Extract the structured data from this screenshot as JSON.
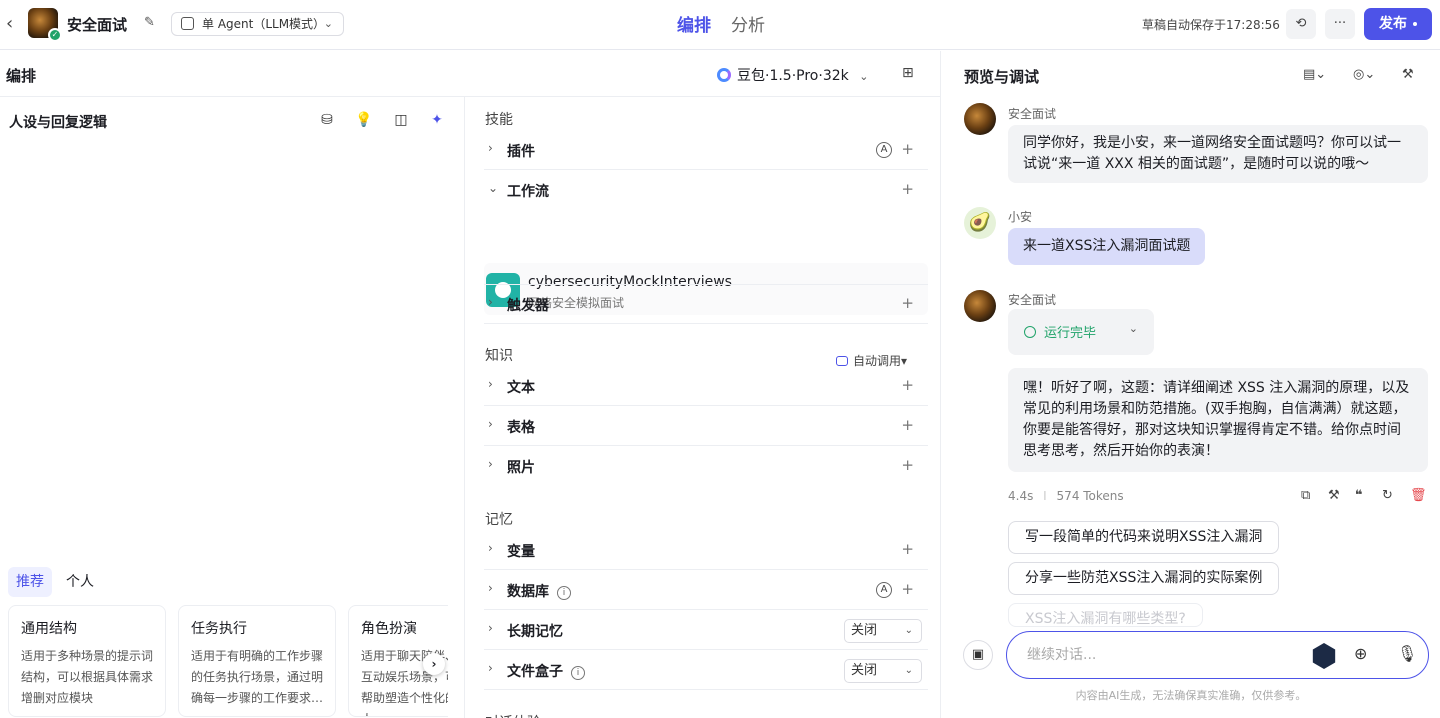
{
  "topbar": {
    "app_title": "安全面试",
    "mode_label": "单 Agent（LLM模式）",
    "tab_edit": "编排",
    "tab_analysis": "分析",
    "autosave": "草稿自动保存于17:28:56",
    "publish_label": "发布",
    "more_label": "···"
  },
  "edit": {
    "title": "编排",
    "model_label": "豆包·1.5·Pro·32k",
    "persona_title": "人设与回复逻辑",
    "template_tabs": [
      "推荐",
      "个人"
    ],
    "templates": [
      {
        "title": "通用结构",
        "desc": "适用于多种场景的提示词结构，可以根据具体需求增删对应模块"
      },
      {
        "title": "任务执行",
        "desc": "适用于有明确的工作步骤的任务执行场景，通过明确每一步骤的工作要求…"
      },
      {
        "title": "角色扮演",
        "desc": "适用于聊天陪伴、互动娱乐场景，可帮助塑造个性化的人…"
      }
    ]
  },
  "skills": {
    "section_skill": "技能",
    "plugins": "插件",
    "workflow": "工作流",
    "workflow_item": {
      "name": "cybersecurityMockInterviews",
      "desc": "网络安全模拟面试"
    },
    "trigger": "触发器",
    "section_knowledge": "知识",
    "auto_call": "自动调用",
    "text": "文本",
    "table": "表格",
    "photo": "照片",
    "section_memory": "记忆",
    "variable": "变量",
    "database": "数据库",
    "long_memory": "长期记忆",
    "long_memory_value": "关闭",
    "filebox": "文件盒子",
    "filebox_value": "关闭",
    "section_dialog": "对话体验"
  },
  "preview": {
    "title": "预览与调试",
    "bot_name": "安全面试",
    "user_name": "小安",
    "greeting": "同学你好，我是小安，来一道网络安全面试题吗？你可以试一试说“来一道 XXX 相关的面试题”，是随时可以说的哦～",
    "user_msg": "来一道XSS注入漏洞面试题",
    "run_status": "运行完毕",
    "answer": "嘿！听好了啊，这题：请详细阐述 XSS 注入漏洞的原理，以及常见的利用场景和防范措施。(双手抱胸，自信满满）就这题，你要是能答得好，那对这块知识掌握得肯定不错。给你点时间思考思考，然后开始你的表演！",
    "latency": "4.4s",
    "tokens": "574 Tokens",
    "suggestions": [
      "写一段简单的代码来说明XSS注入漏洞",
      "分享一些防范XSS注入漏洞的实际案例",
      "XSS注入漏洞有哪些类型?"
    ],
    "input_placeholder": "继续对话...",
    "disclaimer": "内容由AI生成，无法确保真实准确，仅供参考。"
  },
  "colors": {
    "accent": "#4d53e8",
    "success": "#21a36a",
    "user_bubble": "#d9dcfa"
  }
}
